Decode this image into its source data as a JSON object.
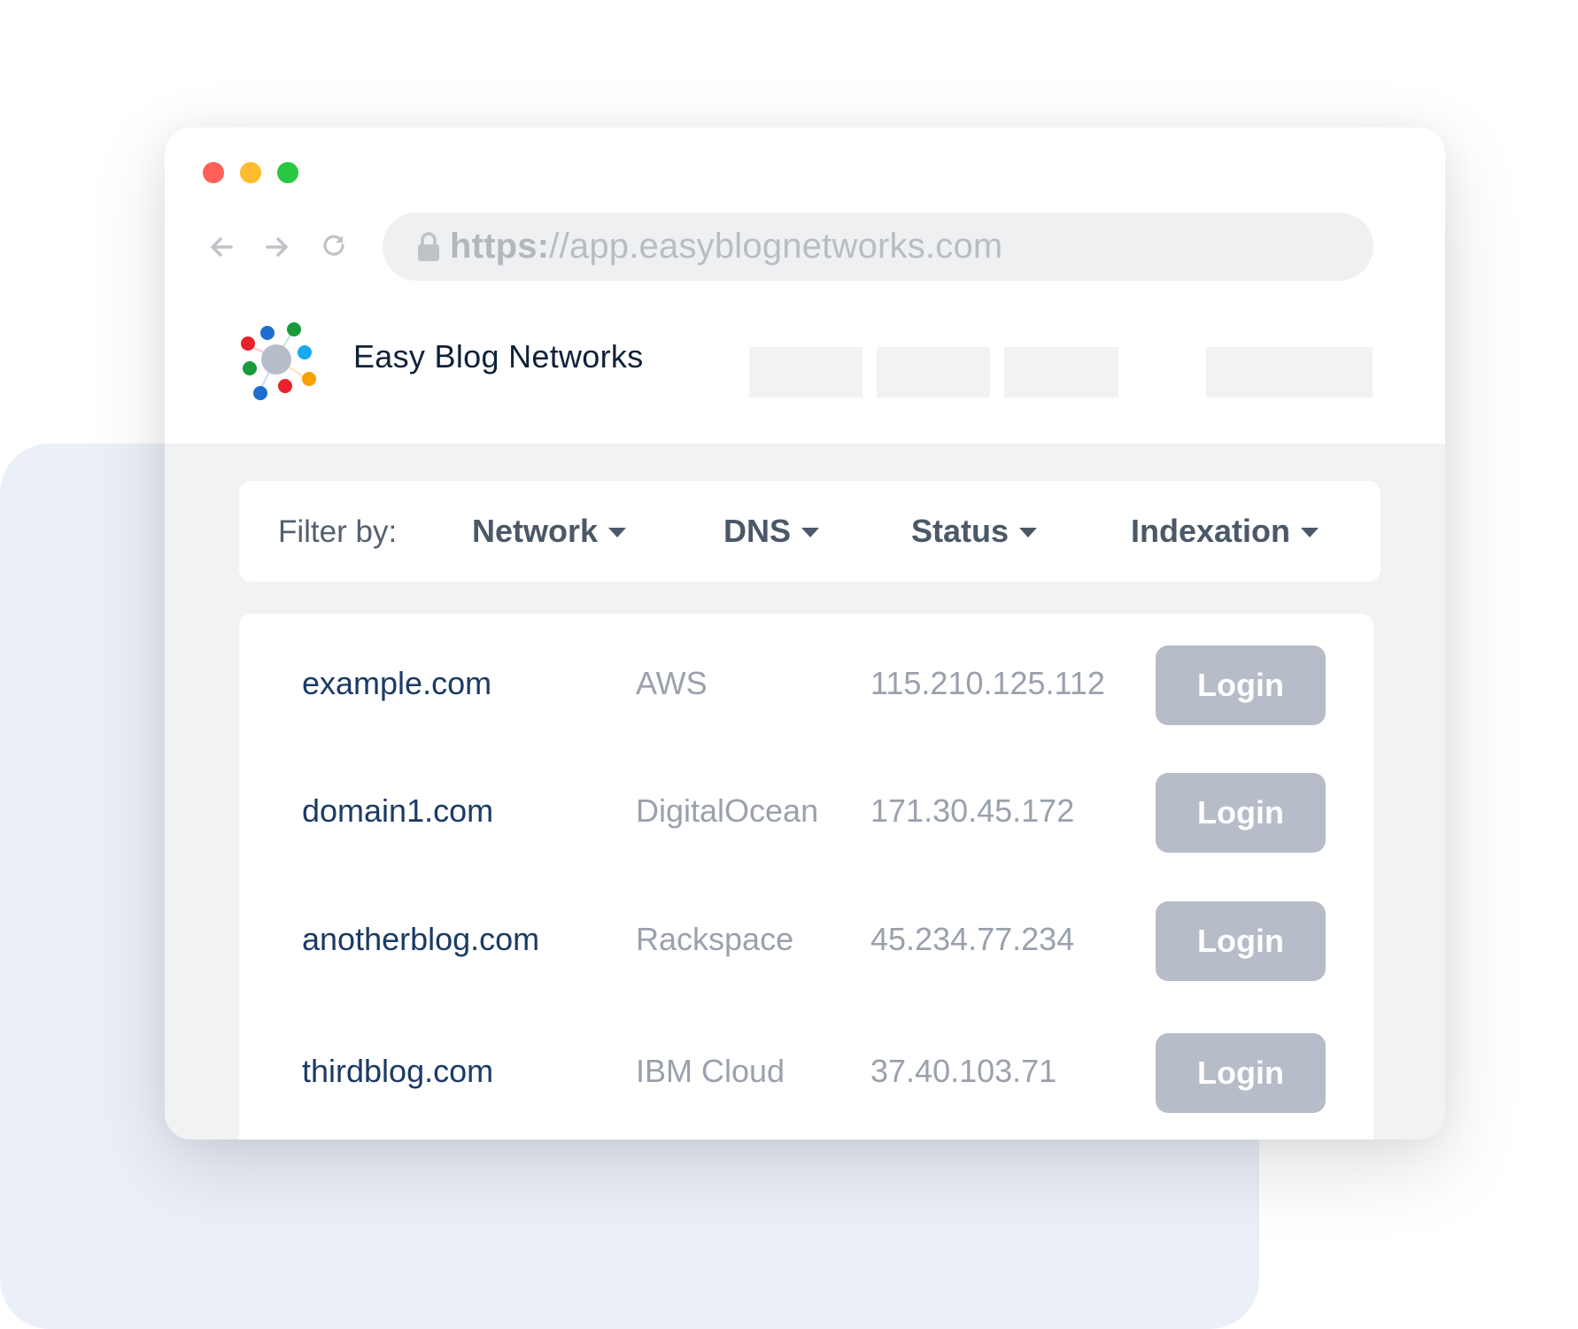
{
  "browser": {
    "window_controls": [
      "close",
      "minimize",
      "maximize"
    ],
    "nav": {
      "back_icon": "arrow-left-icon",
      "forward_icon": "arrow-right-icon",
      "reload_icon": "reload-icon"
    },
    "address_bar": {
      "lock_icon": "lock-icon",
      "scheme": "https:",
      "rest": "//app.easyblognetworks.com"
    }
  },
  "header": {
    "brand": "Easy Blog Networks",
    "logo_icon": "network-logo-icon",
    "logo_colors": [
      "#e8212b",
      "#1f6dd0",
      "#1a9a3a",
      "#18a8f0",
      "#f7a000",
      "#b6bcc8"
    ]
  },
  "filter": {
    "label": "Filter by:",
    "options": [
      {
        "label": "Network"
      },
      {
        "label": "DNS"
      },
      {
        "label": "Status"
      },
      {
        "label": "Indexation"
      }
    ]
  },
  "sites": [
    {
      "domain": "example.com",
      "host": "AWS",
      "ip": "115.210.125.112",
      "action": "Login"
    },
    {
      "domain": "domain1.com",
      "host": "DigitalOcean",
      "ip": "171.30.45.172",
      "action": "Login"
    },
    {
      "domain": "anotherblog.com",
      "host": "Rackspace",
      "ip": "45.234.77.234",
      "action": "Login"
    },
    {
      "domain": "thirdblog.com",
      "host": "IBM Cloud",
      "ip": "37.40.103.71",
      "action": "Login"
    }
  ],
  "colors": {
    "close": "#ff5f57",
    "minimize": "#ffbc2e",
    "maximize": "#28c840",
    "domain_text": "#1b3a66",
    "muted_text": "#9aa1ad",
    "button": "#b6bcc8",
    "background_accent": "#eaeff8"
  }
}
